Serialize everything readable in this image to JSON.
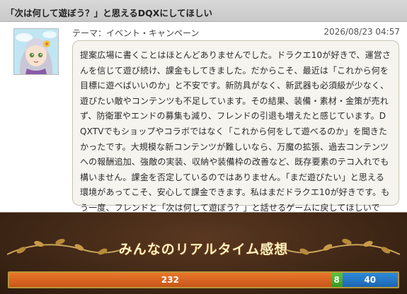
{
  "title": "「次は何して遊ぼう？」と思えるDQXにしてほしい",
  "post": {
    "theme": "テーマ：イベント・キャンペーン",
    "timestamp": "2026/08/23 04:57",
    "body": "提案広場に書くことはほとんどありませんでした。ドラクエ10が好きで、運営さんを信じて遊び続け、課金もしてきました。だからこそ、最近は「これから何を目標に遊べばいいのか」と不安です。新防具がなく、新武器も必須級が少なく、遊びたい敵やコンテンツも不足しています。その結果、装備・素材・金策が売れず、防衛軍やエンドの募集も減り、フレンドの引退も増えたと感じています。DQXTVでもショップやコラボではなく「これから何をして遊べるのか」を聞きたかったです。大規模な新コンテンツが難しいなら、万魔の拡張、過去コンテンツへの報酬追加、強敵の実装、収納や装備枠の改善など、既存要素のテコ入れでも構いません。課金を否定しているのではありません。「まだ遊びたい」と思える環境があってこそ、安心して課金できます。私はまだドラクエ10が好きです。もう一度、フレンドと「次は何して遊ぼう？」と話せるゲームに戻してほしいです。"
  },
  "realtime": {
    "heading": "みんなのリアルタイム感想",
    "votes": [
      {
        "label": "232",
        "value": 232,
        "color": "#d9661f"
      },
      {
        "label": "8",
        "value": 8,
        "color": "#4aae2e"
      },
      {
        "label": "40",
        "value": 40,
        "color": "#2677c6"
      }
    ]
  },
  "icons": {
    "avatar": "character-avatar",
    "ornament": "vine-leaf-ornament"
  }
}
